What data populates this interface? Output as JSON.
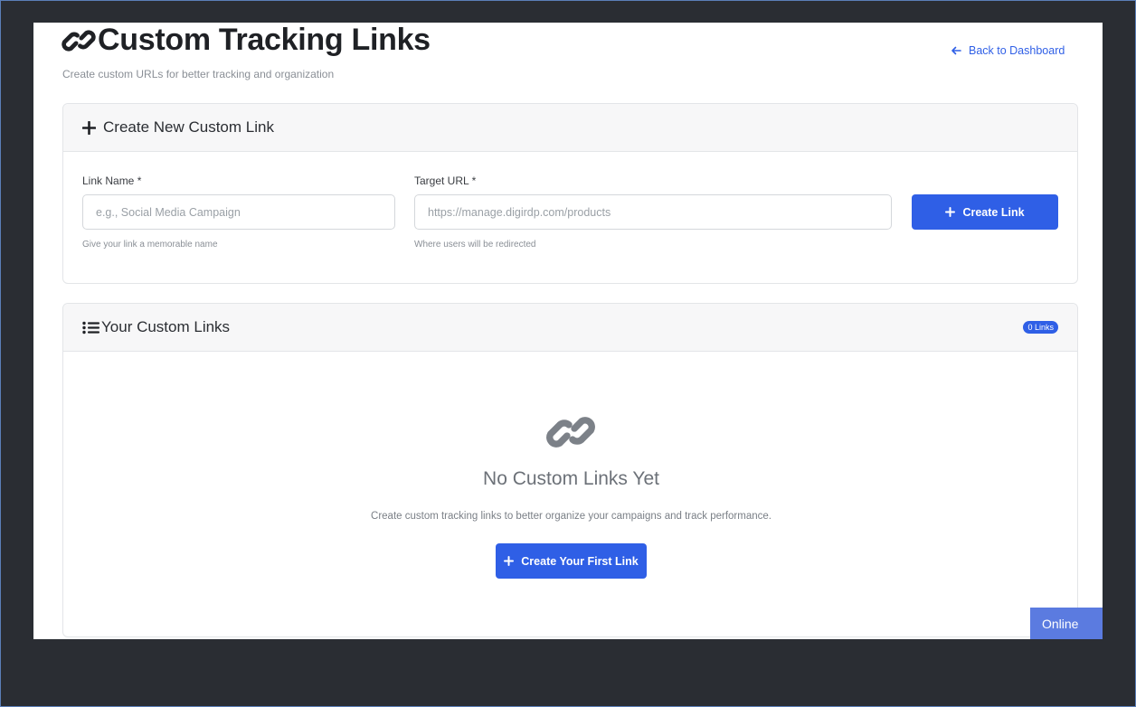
{
  "header": {
    "title": "Custom Tracking Links",
    "subtitle": "Create custom URLs for better tracking and organization",
    "back_label": "Back to Dashboard"
  },
  "create_card": {
    "title": "Create New Custom Link",
    "link_name_label": "Link Name *",
    "link_name_placeholder": "e.g., Social Media Campaign",
    "link_name_help": "Give your link a memorable name",
    "target_url_label": "Target URL *",
    "target_url_placeholder": "https://manage.digirdp.com/products",
    "target_url_help": "Where users will be redirected",
    "create_button": "Create Link"
  },
  "links_card": {
    "title": "Your Custom Links",
    "badge": "0 Links",
    "empty_title": "No Custom Links Yet",
    "empty_text": "Create custom tracking links to better organize your campaigns and track performance.",
    "first_link_button": "Create Your First Link"
  },
  "status": {
    "online_label": "Online"
  },
  "colors": {
    "primary": "#2f5fe6",
    "background": "#2a2d33",
    "online": "#5b7be0"
  },
  "icons": {
    "title": "link-icon",
    "back": "arrow-left-icon",
    "create_header": "plus-icon",
    "list_header": "list-icon",
    "empty": "link-icon"
  }
}
